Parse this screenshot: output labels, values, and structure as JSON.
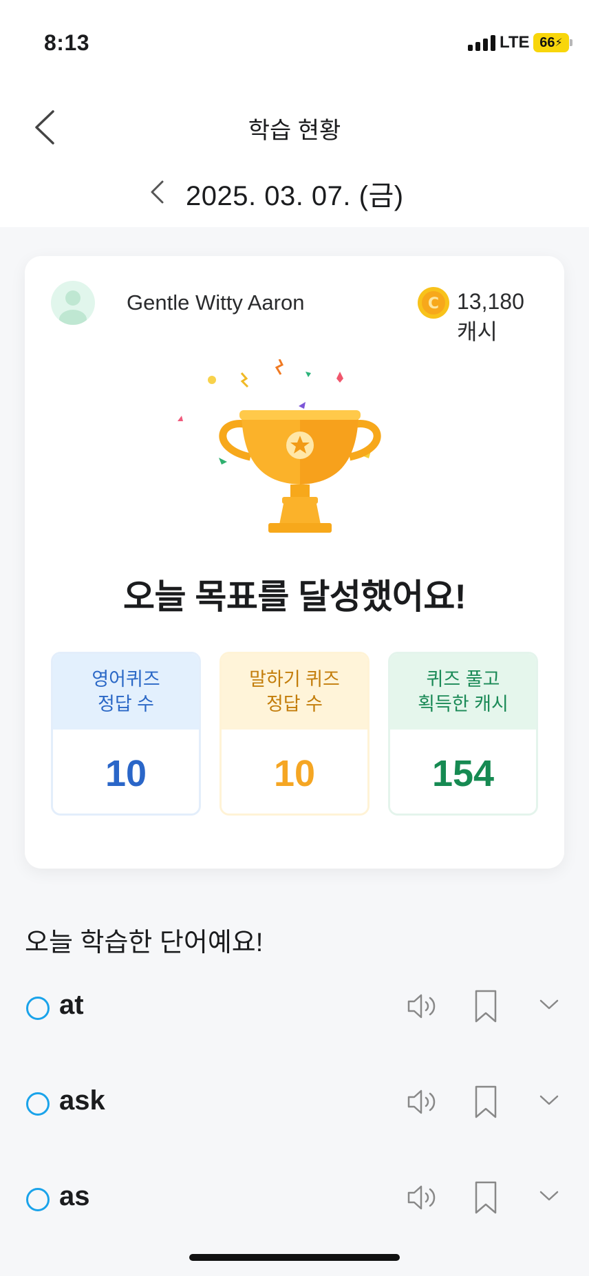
{
  "status_bar": {
    "time": "8:13",
    "network": "LTE",
    "battery": "66"
  },
  "header": {
    "title": "학습 현황",
    "date": "2025. 03. 07. (금)"
  },
  "card": {
    "user_name": "Gentle Witty Aaron",
    "cash": "13,180캐시",
    "goal_title": "오늘 목표를 달성했어요!",
    "stats": [
      {
        "label": "영어퀴즈\n정답 수",
        "value": "10"
      },
      {
        "label": "말하기 퀴즈\n정답 수",
        "value": "10"
      },
      {
        "label": "퀴즈 풀고\n획득한 캐시",
        "value": "154"
      }
    ]
  },
  "words": {
    "title": "오늘 학습한 단어예요!",
    "items": [
      {
        "word": "at"
      },
      {
        "word": "ask"
      },
      {
        "word": "as"
      }
    ]
  },
  "colors": {
    "accent_blue": "#2a66c8",
    "accent_yellow": "#f5a623",
    "accent_green": "#168a52",
    "check_circle": "#1aa3ea"
  },
  "icons": [
    "back-chevron-icon",
    "prev-date-chevron-icon",
    "avatar-icon",
    "coin-icon",
    "trophy-icon",
    "speaker-icon",
    "bookmark-icon",
    "chevron-down-icon"
  ]
}
